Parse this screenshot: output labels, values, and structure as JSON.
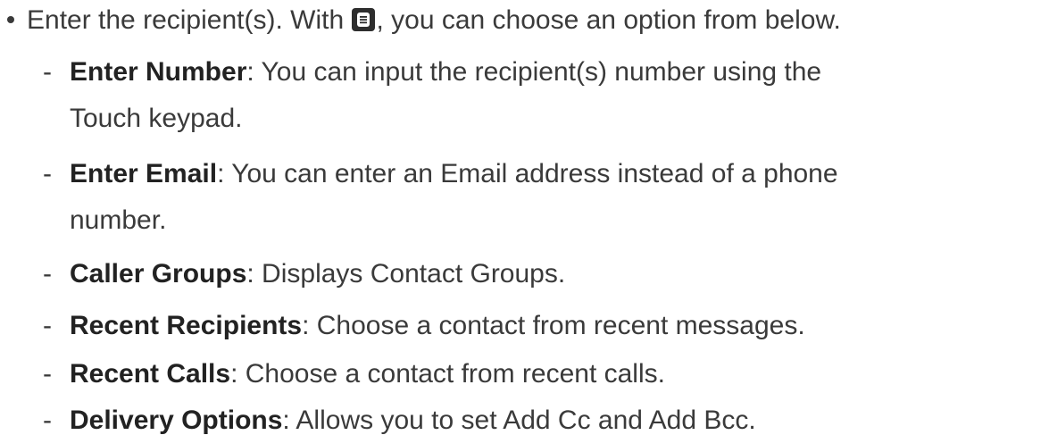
{
  "intro": {
    "text_before_icon": "Enter the recipient(s). With ",
    "icon": "menu-key-icon",
    "text_after_icon": ", you can choose an option from below."
  },
  "options": [
    {
      "dash": "-",
      "label": "Enter Number",
      "description": ": You can input the recipient(s) number using the",
      "description_cont": "Touch keypad."
    },
    {
      "dash": "-",
      "label": "Enter Email",
      "description": ": You can enter an Email address instead of a phone",
      "description_cont": "number."
    },
    {
      "dash": "-",
      "label": "Caller Groups",
      "description": ": Displays Contact Groups."
    },
    {
      "dash": "-",
      "label": "Recent Recipients",
      "description": ": Choose a contact from recent messages."
    },
    {
      "dash": "-",
      "label": "Recent Calls",
      "description": ": Choose a contact from recent calls."
    },
    {
      "dash": "-",
      "label": "Delivery Options",
      "description": ": Allows you to set Add Cc and Add Bcc."
    }
  ]
}
